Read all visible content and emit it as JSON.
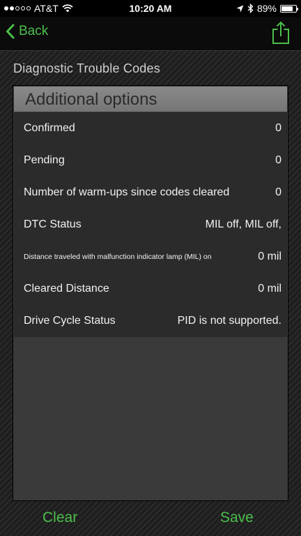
{
  "status_bar": {
    "carrier": "AT&T",
    "time": "10:20 AM",
    "battery": "89%",
    "battery_level": 0.89,
    "signal_bars_filled": 2,
    "signal_bars_total": 5
  },
  "nav": {
    "back_label": "Back",
    "accent_color": "#4cbf4c"
  },
  "page": {
    "title": "Diagnostic Trouble Codes"
  },
  "panel": {
    "header": "Additional options",
    "rows": [
      {
        "label": "Confirmed",
        "value": "0"
      },
      {
        "label": "Pending",
        "value": "0"
      },
      {
        "label": "Number of warm-ups since codes cleared",
        "value": "0"
      },
      {
        "label": "DTC Status",
        "value": "MIL off, MIL off,"
      },
      {
        "label": "Distance traveled with malfunction indicator lamp (MIL) on",
        "value": "0 mil"
      },
      {
        "label": "Cleared Distance",
        "value": "0 mil"
      },
      {
        "label": "Drive Cycle Status",
        "value": "PID is not supported."
      }
    ]
  },
  "toolbar": {
    "clear_label": "Clear",
    "save_label": "Save"
  }
}
